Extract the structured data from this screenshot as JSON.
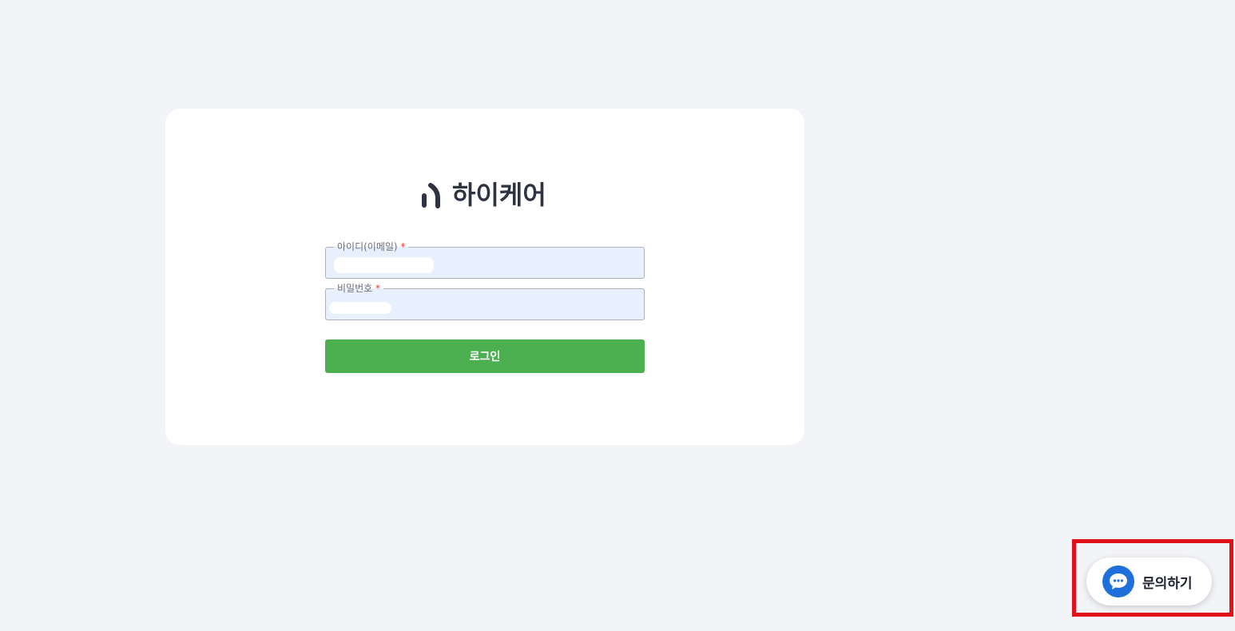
{
  "brand": {
    "name": "하이케어",
    "logo_icon": "brand-logo-icon",
    "text_color": "#2f3240"
  },
  "login_form": {
    "id_field": {
      "label": "아이디(이메일)",
      "required_mark": "*",
      "value": ""
    },
    "password_field": {
      "label": "비밀번호",
      "required_mark": "*",
      "value": ""
    },
    "submit_label": "로그인",
    "submit_color": "#4caf50"
  },
  "inquiry": {
    "label": "문의하기",
    "icon": "chat-bubble-icon",
    "icon_color": "#1e6fd9"
  },
  "colors": {
    "background": "#f3f4f8",
    "card": "#ffffff",
    "input_fill": "#e8f0fe",
    "required": "#e53935",
    "highlight": "#e3101a"
  }
}
